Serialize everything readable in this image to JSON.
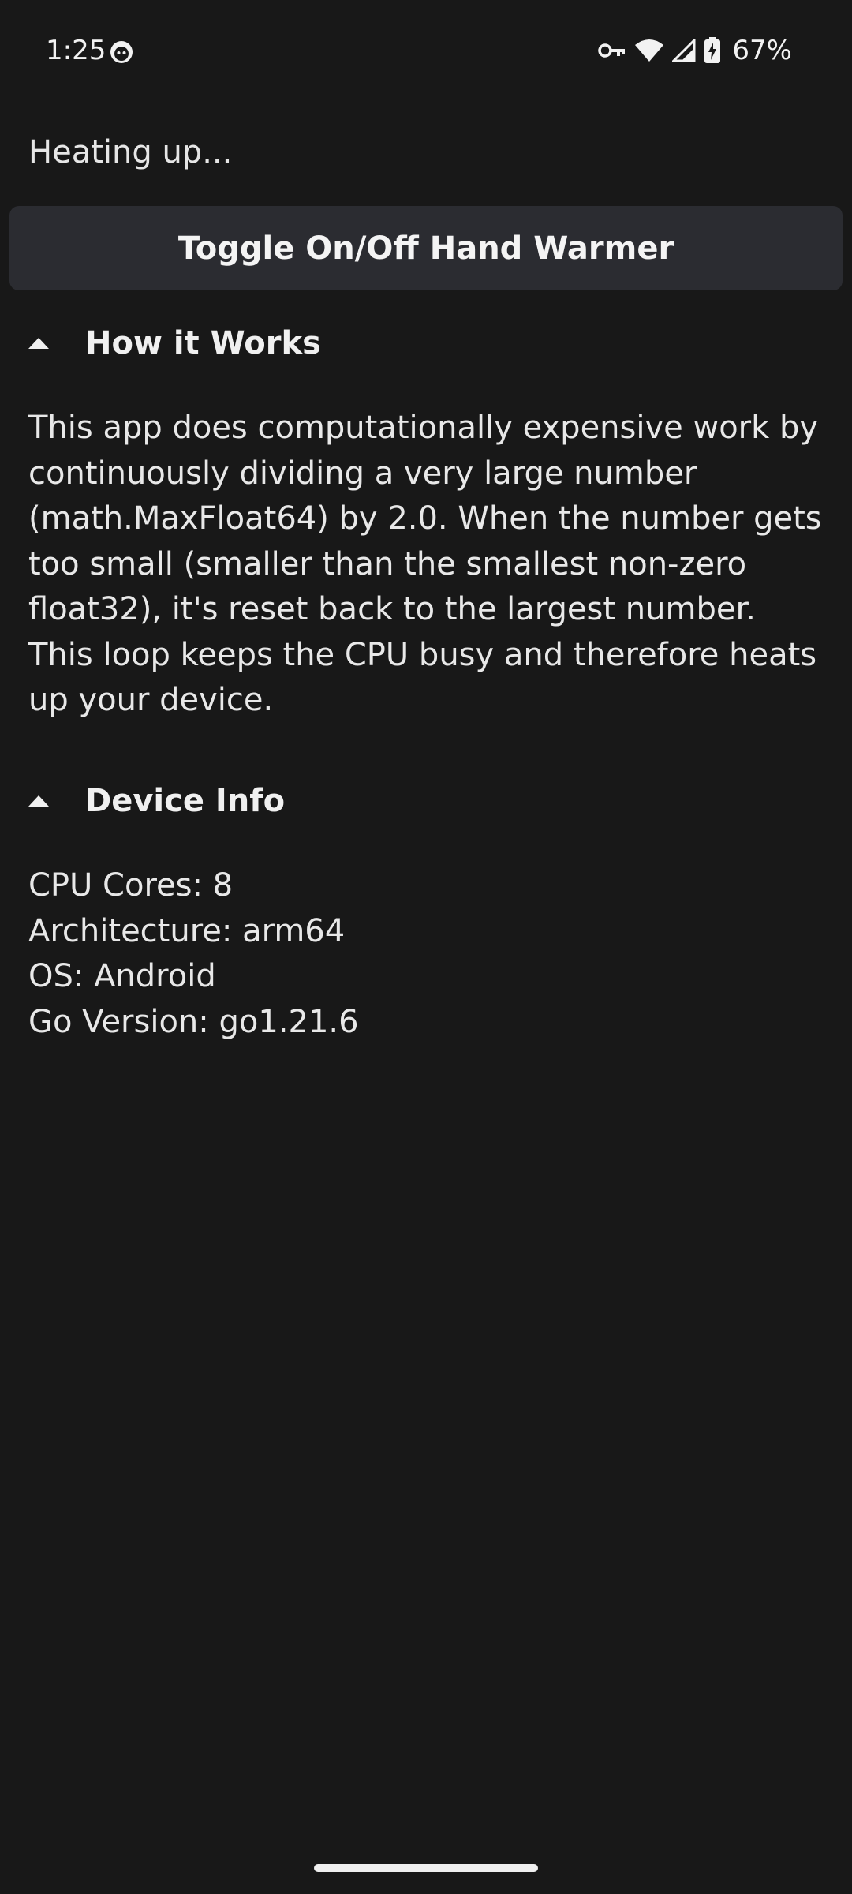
{
  "status_bar": {
    "time": "1:25",
    "battery_percent": "67%",
    "icons": [
      "face-icon",
      "vpn-key-icon",
      "wifi-icon",
      "signal-icon",
      "battery-charging-icon"
    ]
  },
  "app": {
    "status_text": "Heating up...",
    "toggle_label": "Toggle On/Off Hand Warmer",
    "how_it_works": {
      "title": "How it Works",
      "expanded": true,
      "body": "This app does computationally expensive work by continuously dividing a very large number (math.MaxFloat64) by 2.0. When the number gets too small (smaller than the smallest non-zero float32), it's reset back to the largest number. This loop keeps the CPU busy and therefore heats up your device."
    },
    "device_info": {
      "title": "Device Info",
      "expanded": true,
      "lines": [
        "CPU Cores: 8",
        "Architecture: arm64",
        "OS: Android",
        "Go Version: go1.21.6"
      ]
    }
  },
  "colors": {
    "background": "#181818",
    "button": "#2B2C31",
    "text": "#E8E8E8"
  }
}
